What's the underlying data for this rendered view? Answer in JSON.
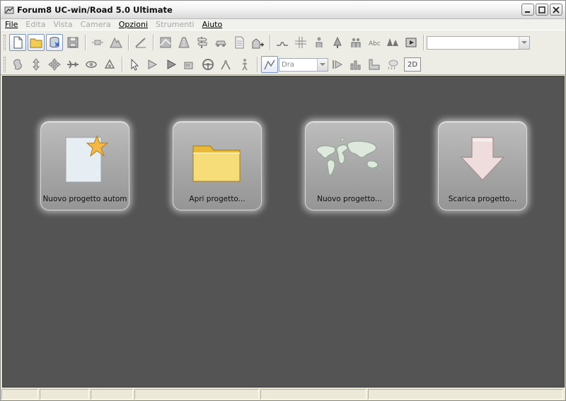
{
  "window": {
    "title": "Forum8 UC-win/Road 5.0 Ultimate",
    "controls": [
      "minimize",
      "maximize",
      "close"
    ]
  },
  "menu": [
    {
      "label": "File",
      "enabled": true
    },
    {
      "label": "Edita",
      "enabled": false
    },
    {
      "label": "Vista",
      "enabled": false
    },
    {
      "label": "Camera",
      "enabled": false
    },
    {
      "label": "Opzioni",
      "enabled": true
    },
    {
      "label": "Strumenti",
      "enabled": false
    },
    {
      "label": "Aiuto",
      "enabled": true
    }
  ],
  "toolbar": {
    "row1_combo_value": "",
    "row2_combo_value": "Dra",
    "view_2d_label": "2D"
  },
  "cards": [
    {
      "label": "Nuovo progetto autom",
      "icon": "new-project-star-icon"
    },
    {
      "label": "Apri progetto...",
      "icon": "folder-icon"
    },
    {
      "label": "Nuovo progetto...",
      "icon": "world-map-icon"
    },
    {
      "label": "Scarica progetto...",
      "icon": "download-arrow-icon"
    }
  ],
  "colors": {
    "workspace": "#545454",
    "card": "#a6a6a6",
    "folder": "#f2cd55",
    "star": "#f3b845"
  }
}
